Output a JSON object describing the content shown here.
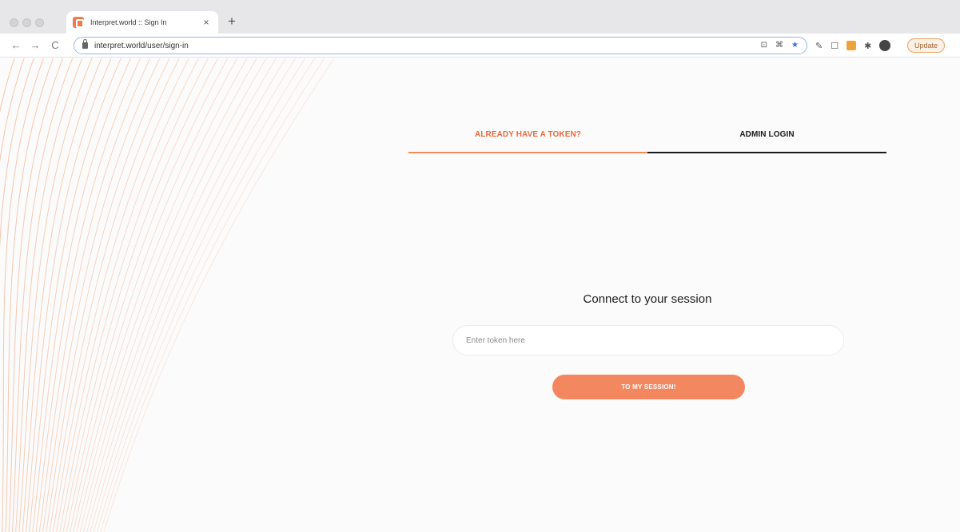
{
  "browser": {
    "tab_title": "Interpret.world :: Sign In",
    "tab_close": "×",
    "new_tab": "+",
    "url": "interpret.world/user/sign-in",
    "update_label": "Update",
    "nav": {
      "back": "←",
      "forward": "→",
      "reload": "C"
    },
    "omni_icons": {
      "cast": "⊡",
      "shortcut": "⌘",
      "star": "★"
    },
    "ext_icons": {
      "eyedropper": "✎",
      "capture": "☐",
      "puzzle": "✱"
    }
  },
  "auth": {
    "tabs": [
      {
        "label": "ALREADY HAVE A TOKEN?",
        "active": true
      },
      {
        "label": "ADMIN LOGIN",
        "active": false
      }
    ],
    "heading": "Connect to your session",
    "token_placeholder": "Enter token here",
    "submit_label": "TO MY SESSION!"
  },
  "colors": {
    "accent": "#f3875f",
    "active_tab_text": "#e86a3c",
    "wave_line": "#f2b999"
  }
}
